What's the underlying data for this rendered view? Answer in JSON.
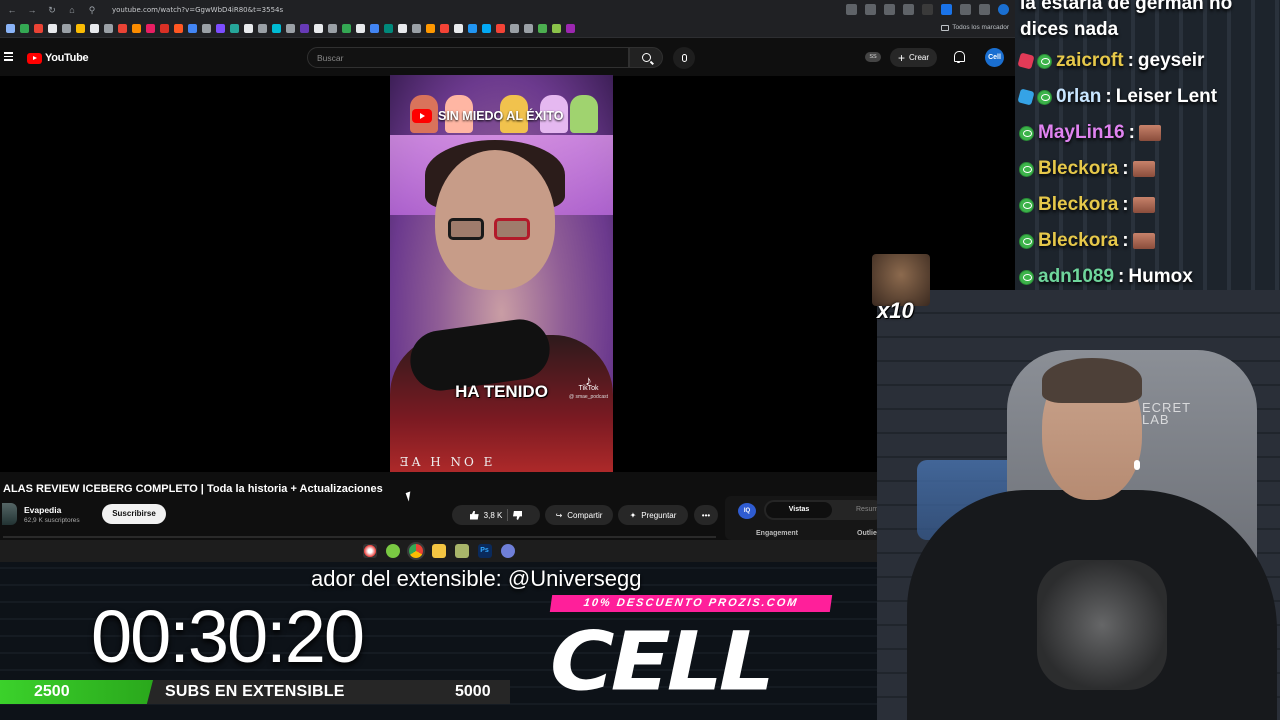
{
  "browser": {
    "url": "youtube.com/watch?v=GgwWbD4iR80&t=3554s",
    "bookmarks_folder": "Todos los marcador"
  },
  "header": {
    "logo_text": "YouTube",
    "search_placeholder": "Buscar",
    "ss_badge": "SS",
    "create_label": "Crear",
    "avatar_initials": "Cell"
  },
  "video": {
    "overlay_title": "SIN MIEDO AL ÉXITO",
    "caption": "HA TENIDO",
    "tiktok_label": "TikTok",
    "tiktok_handle": "@ smae_podcast",
    "shirt_text": "ƎA H NO E"
  },
  "meta": {
    "title": "ALAS REVIEW ICEBERG COMPLETO | Toda la historia + Actualizaciones",
    "channel": "Evapedia",
    "subscribers": "62,9 K suscriptores",
    "subscribe_label": "Suscribirse",
    "likes": "3,8 K",
    "share_label": "Compartir",
    "ask_label": "Preguntar",
    "more_label": "•••"
  },
  "widget": {
    "iq_label": "IQ",
    "tab_active": "Vistas",
    "tab_other": "Resum",
    "label_engagement": "Engagement",
    "label_outlier": "Outlie"
  },
  "overlay": {
    "ticker": "ador del extensible: @Universegg",
    "timer": "00:30:20",
    "progress_min": "2500",
    "progress_label": "SUBS EN EXTENSIBLE",
    "progress_max": "5000",
    "progress_fraction": 0.2,
    "promo": "10% DESCUENTO PROZIS.COM",
    "logo": "CELL"
  },
  "chat": {
    "top_text_1": "la estaría de germán no",
    "top_text_2": "dices nada",
    "messages": [
      {
        "user": "zaicroft",
        "user_color": "#e6c84a",
        "msg": "geyseir"
      },
      {
        "user": "0rlan",
        "user_color": "#c9e6ff",
        "msg": "Leiser Lent"
      },
      {
        "user": "MayLin16",
        "user_color": "#e083f0",
        "msg": ""
      },
      {
        "user": "Bleckora",
        "user_color": "#e6c84a",
        "msg": ""
      },
      {
        "user": "Bleckora",
        "user_color": "#e6c84a",
        "msg": ""
      },
      {
        "user": "Bleckora",
        "user_color": "#e6c84a",
        "msg": ""
      },
      {
        "user": "adn1089",
        "user_color": "#6fd69c",
        "msg": "Humox"
      }
    ],
    "emote_multiplier": "x10"
  },
  "webcam": {
    "chair_text_1": "ECRET",
    "chair_text_2": "LAB"
  },
  "colors": {
    "youtube_red": "#ff0000",
    "progress_green": "#3bd12b",
    "promo_pink": "#ff1f9a"
  },
  "icons": [
    "menu-icon",
    "youtube-logo-icon",
    "search-icon",
    "microphone-icon",
    "plus-icon",
    "bell-icon",
    "like-icon",
    "dislike-icon",
    "share-icon",
    "sparkle-icon",
    "more-icon"
  ]
}
